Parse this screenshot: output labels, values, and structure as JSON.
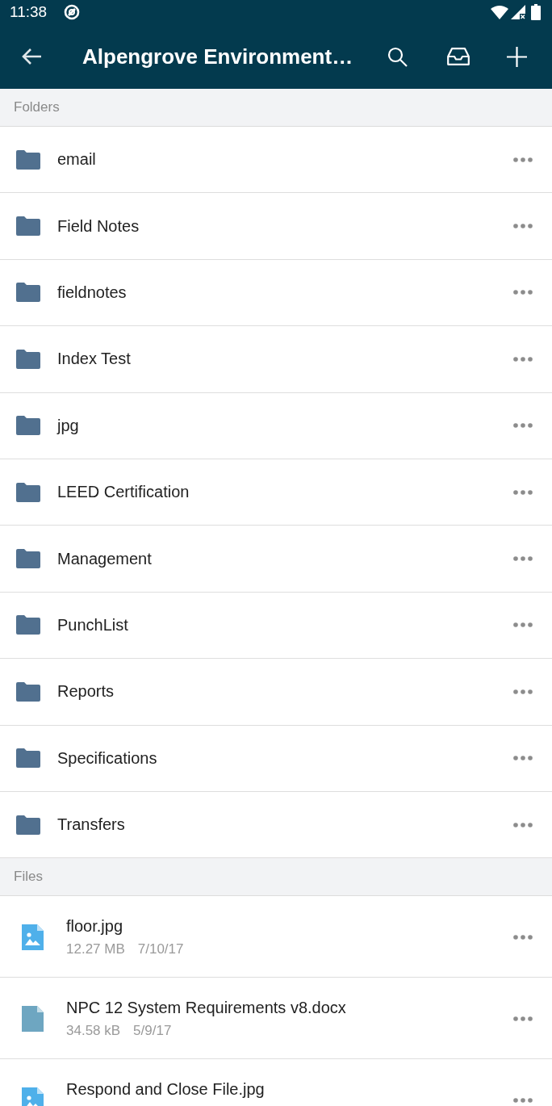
{
  "status_bar": {
    "time": "11:38"
  },
  "toolbar": {
    "title": "Alpengrove Environment…"
  },
  "sections": [
    {
      "heading": "Folders",
      "items": [
        {
          "kind": "folder",
          "name": "email"
        },
        {
          "kind": "folder",
          "name": "Field Notes"
        },
        {
          "kind": "folder",
          "name": "fieldnotes"
        },
        {
          "kind": "folder",
          "name": "Index Test"
        },
        {
          "kind": "folder",
          "name": "jpg"
        },
        {
          "kind": "folder",
          "name": "LEED Certification"
        },
        {
          "kind": "folder",
          "name": "Management"
        },
        {
          "kind": "folder",
          "name": "PunchList"
        },
        {
          "kind": "folder",
          "name": "Reports"
        },
        {
          "kind": "folder",
          "name": "Specifications"
        },
        {
          "kind": "folder",
          "name": "Transfers"
        }
      ]
    },
    {
      "heading": "Files",
      "items": [
        {
          "kind": "image",
          "name": "floor.jpg",
          "size": "12.27 MB",
          "date": "7/10/17"
        },
        {
          "kind": "document",
          "name": "NPC 12 System Requirements v8.docx",
          "size": "34.58 kB",
          "date": "5/9/17"
        },
        {
          "kind": "image",
          "name": "Respond and Close File.jpg"
        }
      ]
    }
  ]
}
